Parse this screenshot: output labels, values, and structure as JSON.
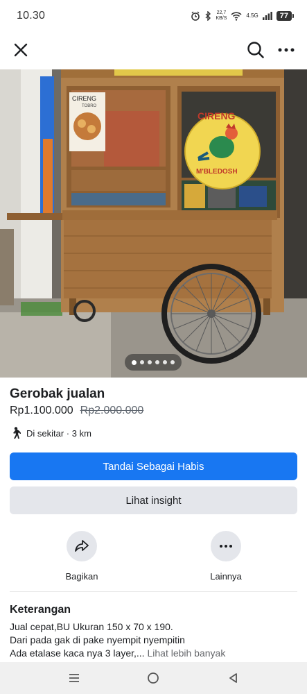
{
  "status_bar": {
    "time": "10.30",
    "speed_value": "22,7",
    "speed_unit": "KB/S",
    "network": "4.5G",
    "battery": "77"
  },
  "listing": {
    "title": "Gerobak jualan",
    "price": "Rp1.100.000",
    "original_price": "Rp2.000.000",
    "location": "Di sekitar · 3 km",
    "image_count": 6,
    "current_image": 1,
    "sign_text_top": "CIRENG",
    "sign_text_bottom": "M'BLEDOSH",
    "poster_text_top": "CIRENG",
    "poster_text_sub": "TOBRO"
  },
  "buttons": {
    "mark_sold": "Tandai Sebagai Habis",
    "insight": "Lihat insight"
  },
  "actions": {
    "share": "Bagikan",
    "more": "Lainnya"
  },
  "description": {
    "heading": "Keterangan",
    "line1": "Jual cepat,BU Ukuran 150 x 70 x 190.",
    "line2": "Dari pada gak di pake nyempit nyempitin",
    "line3": "Ada etalase kaca nya 3 layer,...",
    "see_more": "Lihat lebih banyak"
  },
  "colors": {
    "primary": "#1877f2",
    "secondary_bg": "#e4e6eb",
    "text": "#1c1e21",
    "muted": "#606770"
  }
}
